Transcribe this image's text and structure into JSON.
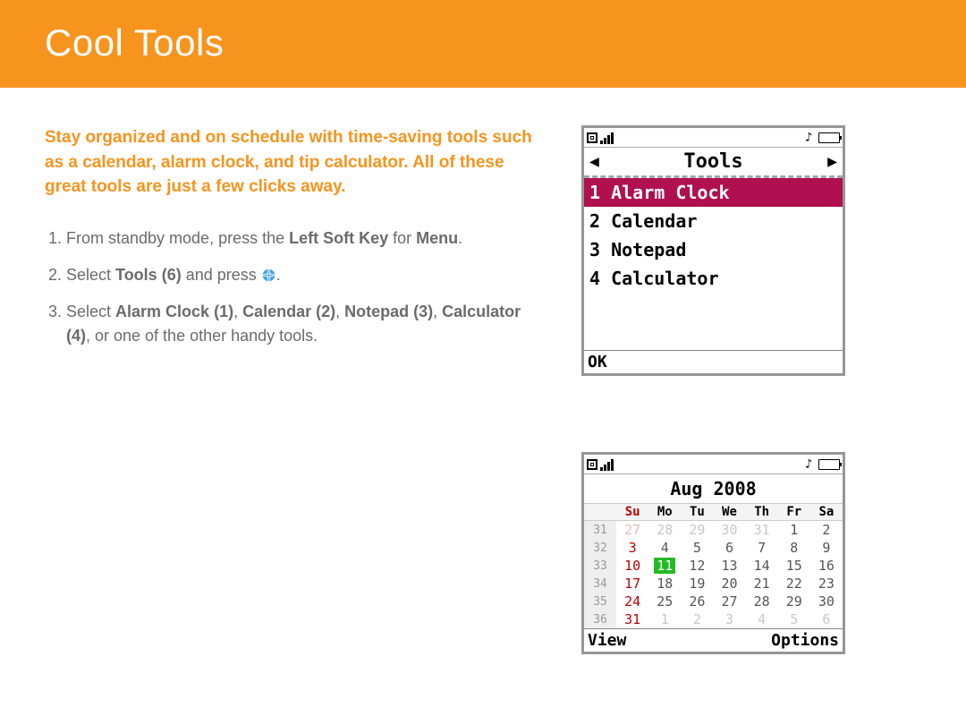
{
  "header": {
    "title": "Cool Tools"
  },
  "intro": "Stay organized and on schedule with time-saving tools such as a calendar, alarm clock, and tip calculator. All of these great tools are just a few clicks away.",
  "steps": {
    "s1a": "From standby mode, press the ",
    "s1b": "Left Soft Key",
    "s1c": " for ",
    "s1d": "Menu",
    "s1e": ".",
    "s2a": "Select ",
    "s2b": "Tools (6)",
    "s2c": " and press ",
    "s2d": ".",
    "s3a": "Select ",
    "s3b": "Alarm Clock (1)",
    "s3c": ", ",
    "s3d": "Calendar (2)",
    "s3e": ", ",
    "s3f": "Notepad (3)",
    "s3g": ", ",
    "s3h": "Calculator (4)",
    "s3i": ", or one of the other handy tools."
  },
  "phone1": {
    "tab_title": "Tools",
    "items": [
      "1 Alarm Clock",
      "2 Calendar",
      "3 Notepad",
      "4 Calculator"
    ],
    "selected_index": 0,
    "softkey_left": "OK",
    "softkey_right": ""
  },
  "phone2": {
    "month_title": "Aug 2008",
    "day_headers": [
      "Su",
      "Mo",
      "Tu",
      "We",
      "Th",
      "Fr",
      "Sa"
    ],
    "weeks": [
      {
        "wk": "31",
        "days": [
          {
            "n": "27",
            "other": true,
            "sun": true
          },
          {
            "n": "28",
            "other": true
          },
          {
            "n": "29",
            "other": true
          },
          {
            "n": "30",
            "other": true
          },
          {
            "n": "31",
            "other": true
          },
          {
            "n": "1"
          },
          {
            "n": "2"
          }
        ]
      },
      {
        "wk": "32",
        "days": [
          {
            "n": "3",
            "sun": true
          },
          {
            "n": "4"
          },
          {
            "n": "5"
          },
          {
            "n": "6"
          },
          {
            "n": "7"
          },
          {
            "n": "8"
          },
          {
            "n": "9"
          }
        ]
      },
      {
        "wk": "33",
        "days": [
          {
            "n": "10",
            "sun": true
          },
          {
            "n": "11",
            "today": true
          },
          {
            "n": "12"
          },
          {
            "n": "13"
          },
          {
            "n": "14"
          },
          {
            "n": "15"
          },
          {
            "n": "16"
          }
        ]
      },
      {
        "wk": "34",
        "days": [
          {
            "n": "17",
            "sun": true
          },
          {
            "n": "18"
          },
          {
            "n": "19"
          },
          {
            "n": "20"
          },
          {
            "n": "21"
          },
          {
            "n": "22"
          },
          {
            "n": "23"
          }
        ]
      },
      {
        "wk": "35",
        "days": [
          {
            "n": "24",
            "sun": true
          },
          {
            "n": "25"
          },
          {
            "n": "26"
          },
          {
            "n": "27"
          },
          {
            "n": "28"
          },
          {
            "n": "29"
          },
          {
            "n": "30"
          }
        ]
      },
      {
        "wk": "36",
        "days": [
          {
            "n": "31",
            "sun": true
          },
          {
            "n": "1",
            "other": true
          },
          {
            "n": "2",
            "other": true
          },
          {
            "n": "3",
            "other": true
          },
          {
            "n": "4",
            "other": true
          },
          {
            "n": "5",
            "other": true
          },
          {
            "n": "6",
            "other": true
          }
        ]
      }
    ],
    "softkey_left": "View",
    "softkey_right": "Options"
  }
}
